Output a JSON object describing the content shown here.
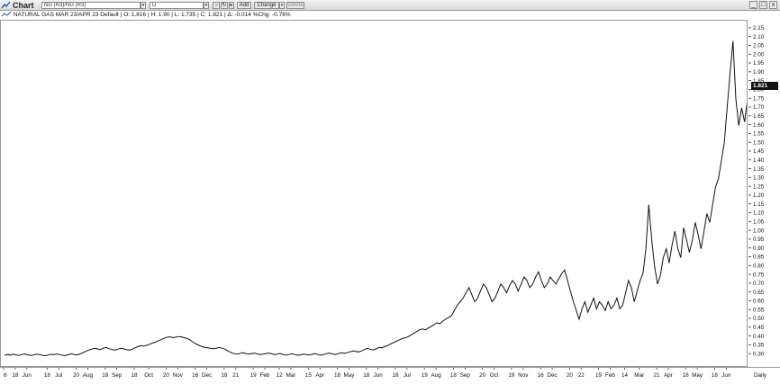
{
  "window": {
    "title": "Chart",
    "symbol_field": "NG (R3)/NG (R3)",
    "period_field": "D",
    "add_label": "Add",
    "change_label": "Change",
    "delete_label": "Delete",
    "minimize_glyph": "_",
    "maximize_glyph": "□",
    "close_glyph": "x"
  },
  "info": {
    "contract": "NATURAL GAS MAR 23/APR 23",
    "template": "Default",
    "open": "O: 1.816",
    "high": "H: 1.90",
    "low": "L: 1.735",
    "close": "C: 1.821",
    "change": "Δ: -0.014",
    "pct_change": "%Chg: -0.76%"
  },
  "last_price_tag": "1.821",
  "x_period_label": "Daily",
  "colors": {
    "line": "#111111",
    "grid": "#ffffff",
    "axis": "#999999"
  },
  "chart_data": {
    "type": "line",
    "ylim": [
      0.25,
      2.18
    ],
    "y_ticks": [
      "0.30",
      "0.35",
      "0.40",
      "0.45",
      "0.50",
      "0.55",
      "0.60",
      "0.65",
      "0.70",
      "0.75",
      "0.80",
      "0.85",
      "0.90",
      "0.95",
      "1.00",
      "1.05",
      "1.10",
      "1.15",
      "1.20",
      "1.25",
      "1.30",
      "1.35",
      "1.40",
      "1.45",
      "1.50",
      "1.55",
      "1.60",
      "1.65",
      "1.70",
      "1.75",
      "1.80",
      "1.85",
      "1.90",
      "1.95",
      "2.00",
      "2.05",
      "2.10",
      "2.15"
    ],
    "x_ticks": [
      {
        "label": "6",
        "i": 0
      },
      {
        "label": "18",
        "i": 4
      },
      {
        "label": "Jun",
        "i": 8
      },
      {
        "label": "18",
        "i": 15
      },
      {
        "label": "Jul",
        "i": 19
      },
      {
        "label": "20",
        "i": 25
      },
      {
        "label": "Aug",
        "i": 29
      },
      {
        "label": "18",
        "i": 35
      },
      {
        "label": "Sep",
        "i": 39
      },
      {
        "label": "18",
        "i": 45
      },
      {
        "label": "Oct",
        "i": 50
      },
      {
        "label": "20",
        "i": 56
      },
      {
        "label": "Nov",
        "i": 60
      },
      {
        "label": "16",
        "i": 66
      },
      {
        "label": "Dec",
        "i": 70
      },
      {
        "label": "18",
        "i": 76
      },
      {
        "label": "21",
        "i": 80
      },
      {
        "label": "19",
        "i": 86
      },
      {
        "label": "Feb",
        "i": 90
      },
      {
        "label": "12",
        "i": 95
      },
      {
        "label": "Mar",
        "i": 99
      },
      {
        "label": "15",
        "i": 105
      },
      {
        "label": "Apr",
        "i": 109
      },
      {
        "label": "18",
        "i": 115
      },
      {
        "label": "May",
        "i": 119
      },
      {
        "label": "18",
        "i": 125
      },
      {
        "label": "Jun",
        "i": 129
      },
      {
        "label": "18",
        "i": 135
      },
      {
        "label": "Jul",
        "i": 139
      },
      {
        "label": "19",
        "i": 145
      },
      {
        "label": "Aug",
        "i": 149
      },
      {
        "label": "18",
        "i": 155
      },
      {
        "label": "Sep",
        "i": 159
      },
      {
        "label": "20",
        "i": 165
      },
      {
        "label": "Oct",
        "i": 169
      },
      {
        "label": "19",
        "i": 175
      },
      {
        "label": "Nov",
        "i": 179
      },
      {
        "label": "16",
        "i": 185
      },
      {
        "label": "Dec",
        "i": 189
      },
      {
        "label": "20",
        "i": 195
      },
      {
        "label": "22",
        "i": 199
      },
      {
        "label": "19",
        "i": 205
      },
      {
        "label": "Feb",
        "i": 209
      },
      {
        "label": "14",
        "i": 214
      },
      {
        "label": "Mar",
        "i": 219
      },
      {
        "label": "21",
        "i": 225
      },
      {
        "label": "Apr",
        "i": 229
      },
      {
        "label": "18",
        "i": 235
      },
      {
        "label": "May",
        "i": 239
      },
      {
        "label": "18",
        "i": 245
      },
      {
        "label": "Jun",
        "i": 249
      }
    ],
    "n_slots": 253,
    "series": [
      {
        "values": [
          0.295,
          0.3,
          0.297,
          0.302,
          0.298,
          0.295,
          0.3,
          0.303,
          0.298,
          0.295,
          0.297,
          0.302,
          0.3,
          0.296,
          0.293,
          0.297,
          0.301,
          0.299,
          0.303,
          0.3,
          0.296,
          0.294,
          0.299,
          0.304,
          0.3,
          0.298,
          0.303,
          0.31,
          0.318,
          0.325,
          0.33,
          0.335,
          0.332,
          0.328,
          0.336,
          0.34,
          0.333,
          0.328,
          0.325,
          0.33,
          0.335,
          0.332,
          0.328,
          0.325,
          0.33,
          0.338,
          0.345,
          0.35,
          0.348,
          0.352,
          0.358,
          0.365,
          0.37,
          0.378,
          0.385,
          0.392,
          0.398,
          0.4,
          0.396,
          0.398,
          0.402,
          0.4,
          0.395,
          0.39,
          0.382,
          0.37,
          0.36,
          0.352,
          0.345,
          0.34,
          0.338,
          0.335,
          0.333,
          0.336,
          0.34,
          0.336,
          0.33,
          0.32,
          0.312,
          0.305,
          0.302,
          0.305,
          0.31,
          0.306,
          0.302,
          0.305,
          0.308,
          0.304,
          0.3,
          0.302,
          0.305,
          0.308,
          0.304,
          0.3,
          0.302,
          0.306,
          0.3,
          0.296,
          0.3,
          0.304,
          0.3,
          0.296,
          0.298,
          0.302,
          0.3,
          0.297,
          0.301,
          0.305,
          0.3,
          0.296,
          0.3,
          0.305,
          0.308,
          0.303,
          0.3,
          0.305,
          0.31,
          0.306,
          0.31,
          0.315,
          0.32,
          0.318,
          0.315,
          0.32,
          0.328,
          0.335,
          0.33,
          0.326,
          0.332,
          0.34,
          0.338,
          0.345,
          0.35,
          0.36,
          0.368,
          0.375,
          0.382,
          0.39,
          0.395,
          0.4,
          0.41,
          0.42,
          0.43,
          0.44,
          0.445,
          0.44,
          0.45,
          0.46,
          0.47,
          0.48,
          0.475,
          0.49,
          0.5,
          0.51,
          0.52,
          0.55,
          0.58,
          0.6,
          0.62,
          0.65,
          0.68,
          0.64,
          0.6,
          0.62,
          0.66,
          0.7,
          0.68,
          0.64,
          0.6,
          0.62,
          0.66,
          0.7,
          0.68,
          0.65,
          0.69,
          0.72,
          0.7,
          0.66,
          0.7,
          0.74,
          0.72,
          0.68,
          0.7,
          0.74,
          0.77,
          0.72,
          0.68,
          0.7,
          0.74,
          0.72,
          0.7,
          0.73,
          0.76,
          0.78,
          0.72,
          0.66,
          0.6,
          0.55,
          0.5,
          0.56,
          0.6,
          0.54,
          0.58,
          0.62,
          0.56,
          0.6,
          0.58,
          0.55,
          0.6,
          0.56,
          0.58,
          0.62,
          0.56,
          0.58,
          0.65,
          0.72,
          0.68,
          0.6,
          0.66,
          0.72,
          0.76,
          0.9,
          1.15,
          0.95,
          0.8,
          0.7,
          0.75,
          0.85,
          0.9,
          0.82,
          0.92,
          1.0,
          0.9,
          0.85,
          1.02,
          0.95,
          0.88,
          0.95,
          1.05,
          0.98,
          0.9,
          1.0,
          1.1,
          1.05,
          1.15,
          1.25,
          1.3,
          1.4,
          1.5,
          1.7,
          1.9,
          2.08,
          1.75,
          1.6,
          1.7,
          1.62,
          1.75,
          1.6,
          1.7,
          2.12,
          1.9,
          1.55,
          1.72,
          1.8,
          1.821
        ]
      }
    ]
  }
}
